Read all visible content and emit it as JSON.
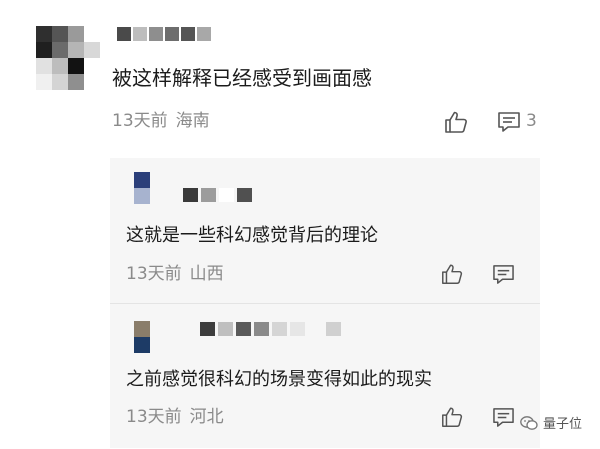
{
  "main_comment": {
    "text": "被这样解释已经感受到画面感",
    "time": "13天前",
    "location": "海南",
    "reply_count": "3",
    "avatar_mosaic": [
      "#2f2f2f",
      "#555555",
      "#9a9a9a",
      "#ffffff",
      "#1f1f1f",
      "#6b6b6b",
      "#b5b5b5",
      "#d8d8d8",
      "#e1e1e1",
      "#bdbdbd",
      "#121212",
      "#ffffff",
      "#f0f0f0",
      "#d4d4d4",
      "#8f8f8f",
      "#ffffff"
    ],
    "name_mosaic": [
      "#4a4a4a",
      "#bdbdbd",
      "#8e8e8e",
      "#6d6d6d",
      "#555555",
      "#a8a8a8"
    ]
  },
  "replies": [
    {
      "text": "这就是一些科幻感觉背后的理论",
      "time": "13天前",
      "location": "山西",
      "avatar_mosaic": [
        "#2b3f7a",
        "#a7b3cf"
      ],
      "name_mosaic": [
        "#3a3a3a",
        "#9c9c9c",
        "#ffffff",
        "#505050"
      ]
    },
    {
      "text": "之前感觉很科幻的场景变得如此的现实",
      "time": "13天前",
      "location": "河北",
      "avatar_mosaic": [
        "#8a7d6a",
        "#1d3b66"
      ],
      "name_mosaic": [
        "#3d3d3d",
        "#bfbfbf",
        "#5a5a5a",
        "#8a8a8a",
        "#d5d5d5",
        "#e6e6e6",
        "#f6f6f6",
        "#d0d0d0"
      ]
    }
  ],
  "watermark": {
    "text": "量子位"
  },
  "colors": {
    "meta_gray": "#8a8a8a",
    "reply_bg": "#f6f6f6",
    "text": "#1b1b1b"
  },
  "icons": {
    "like": "thumbs-up-icon",
    "comment": "speech-bubble-icon",
    "watermark": "wechat-logo-icon"
  }
}
